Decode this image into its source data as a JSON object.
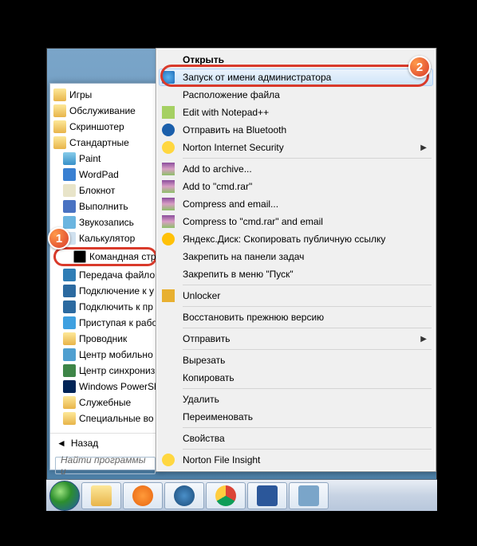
{
  "startMenu": {
    "items": [
      {
        "label": "Игры",
        "type": "folder",
        "indent": 0
      },
      {
        "label": "Обслуживание",
        "type": "folder",
        "indent": 0
      },
      {
        "label": "Скриншотер",
        "type": "folder",
        "indent": 0
      },
      {
        "label": "Стандартные",
        "type": "folder",
        "indent": 0
      },
      {
        "label": "Paint",
        "type": "app",
        "icon": "ico-paint",
        "indent": 1
      },
      {
        "label": "WordPad",
        "type": "app",
        "icon": "ico-wordpad",
        "indent": 1
      },
      {
        "label": "Блокнот",
        "type": "app",
        "icon": "ico-notepad",
        "indent": 1
      },
      {
        "label": "Выполнить",
        "type": "app",
        "icon": "ico-run",
        "indent": 1
      },
      {
        "label": "Звукозапись",
        "type": "app",
        "icon": "ico-sound",
        "indent": 1
      },
      {
        "label": "Калькулятор",
        "type": "app",
        "icon": "ico-calc",
        "indent": 1
      },
      {
        "label": "Командная стро",
        "type": "app",
        "icon": "ico-cmd",
        "indent": 1,
        "selected": true
      },
      {
        "label": "Передача файло",
        "type": "app",
        "icon": "ico-transfer",
        "indent": 1
      },
      {
        "label": "Подключение к у",
        "type": "app",
        "icon": "ico-remote",
        "indent": 1
      },
      {
        "label": "Подключить к пр",
        "type": "app",
        "icon": "ico-remote2",
        "indent": 1
      },
      {
        "label": "Приступая к рабо",
        "type": "app",
        "icon": "ico-getstart",
        "indent": 1
      },
      {
        "label": "Проводник",
        "type": "app",
        "icon": "ico-explorer",
        "indent": 1
      },
      {
        "label": "Центр мобильно",
        "type": "app",
        "icon": "ico-mobility",
        "indent": 1
      },
      {
        "label": "Центр синхрониз",
        "type": "app",
        "icon": "ico-sync",
        "indent": 1
      },
      {
        "label": "Windows PowerSh",
        "type": "folder",
        "indent": 1,
        "icon": "ico-ps"
      },
      {
        "label": "Служебные",
        "type": "folder",
        "indent": 1
      },
      {
        "label": "Специальные во",
        "type": "folder",
        "indent": 1
      }
    ],
    "back": "Назад",
    "searchPlaceholder": "Найти программы и"
  },
  "context": {
    "groups": [
      [
        {
          "label": "Открыть",
          "bold": true,
          "icon": ""
        },
        {
          "label": "Запуск от имени администратора",
          "icon": "ico-shield",
          "hl": true
        },
        {
          "label": "Расположение файла",
          "icon": ""
        },
        {
          "label": "Edit with Notepad++",
          "icon": "ico-npp"
        },
        {
          "label": "Отправить на Bluetooth",
          "icon": "ico-bt"
        },
        {
          "label": "Norton Internet Security",
          "icon": "ico-norton",
          "sub": true
        }
      ],
      [
        {
          "label": "Add to archive...",
          "icon": "ico-rar"
        },
        {
          "label": "Add to \"cmd.rar\"",
          "icon": "ico-rar"
        },
        {
          "label": "Compress and email...",
          "icon": "ico-rar"
        },
        {
          "label": "Compress to \"cmd.rar\" and email",
          "icon": "ico-rar"
        },
        {
          "label": "Яндекс.Диск: Скопировать публичную ссылку",
          "icon": "ico-yadisk"
        },
        {
          "label": "Закрепить на панели задач",
          "icon": ""
        },
        {
          "label": "Закрепить в меню \"Пуск\"",
          "icon": ""
        }
      ],
      [
        {
          "label": "Unlocker",
          "icon": "ico-unlock"
        }
      ],
      [
        {
          "label": "Восстановить прежнюю версию",
          "icon": ""
        }
      ],
      [
        {
          "label": "Отправить",
          "icon": "",
          "sub": true
        }
      ],
      [
        {
          "label": "Вырезать",
          "icon": ""
        },
        {
          "label": "Копировать",
          "icon": ""
        }
      ],
      [
        {
          "label": "Удалить",
          "icon": ""
        },
        {
          "label": "Переименовать",
          "icon": ""
        }
      ],
      [
        {
          "label": "Свойства",
          "icon": ""
        }
      ],
      [
        {
          "label": "Norton File Insight",
          "icon": "ico-nfi"
        }
      ]
    ]
  },
  "badges": {
    "b1": "1",
    "b2": "2"
  },
  "taskbar": {
    "buttons": [
      "explorer",
      "wmp",
      "hp",
      "chrome",
      "word",
      "scan"
    ]
  }
}
